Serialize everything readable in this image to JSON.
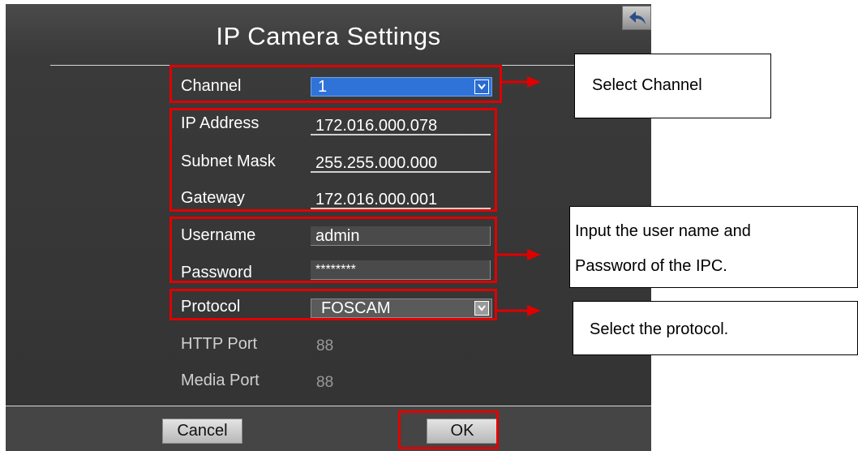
{
  "title": "IP Camera Settings",
  "form": {
    "channel": {
      "label": "Channel",
      "value": "1"
    },
    "ip_address": {
      "label": "IP Address",
      "value": "172.016.000.078"
    },
    "subnet_mask": {
      "label": "Subnet Mask",
      "value": "255.255.000.000"
    },
    "gateway": {
      "label": "Gateway",
      "value": "172.016.000.001"
    },
    "username": {
      "label": "Username",
      "value": "admin"
    },
    "password": {
      "label": "Password",
      "value": "********"
    },
    "protocol": {
      "label": "Protocol",
      "value": "FOSCAM"
    },
    "http_port": {
      "label": "HTTP Port",
      "value": "88"
    },
    "media_port": {
      "label": "Media Port",
      "value": "88"
    }
  },
  "buttons": {
    "cancel": "Cancel",
    "ok": "OK"
  },
  "callouts": {
    "channel": "Select Channel",
    "credentials_line1": "Input the user name and",
    "credentials_line2": "Password of the IPC.",
    "protocol": "Select the protocol."
  },
  "icons": {
    "back": "back-arrow-icon",
    "dropdown": "chevron-down-icon"
  },
  "colors": {
    "highlight_red": "#e00000",
    "select_blue": "#2f73d8",
    "panel_bg": "#333333"
  }
}
